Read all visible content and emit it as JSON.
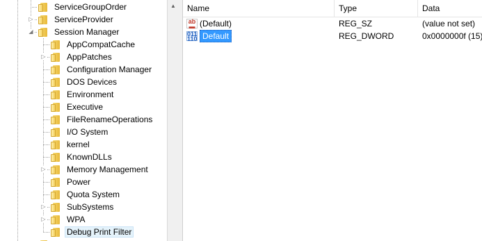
{
  "tree": {
    "items": [
      {
        "label": "ServiceGroupOrder",
        "level": 1,
        "expander": "none"
      },
      {
        "label": "ServiceProvider",
        "level": 1,
        "expander": "collapsed"
      },
      {
        "label": "Session Manager",
        "level": 1,
        "expander": "expanded"
      },
      {
        "label": "AppCompatCache",
        "level": 2,
        "expander": "none"
      },
      {
        "label": "AppPatches",
        "level": 2,
        "expander": "collapsed"
      },
      {
        "label": "Configuration Manager",
        "level": 2,
        "expander": "none"
      },
      {
        "label": "DOS Devices",
        "level": 2,
        "expander": "none"
      },
      {
        "label": "Environment",
        "level": 2,
        "expander": "none"
      },
      {
        "label": "Executive",
        "level": 2,
        "expander": "none"
      },
      {
        "label": "FileRenameOperations",
        "level": 2,
        "expander": "none"
      },
      {
        "label": "I/O System",
        "level": 2,
        "expander": "none"
      },
      {
        "label": "kernel",
        "level": 2,
        "expander": "none"
      },
      {
        "label": "KnownDLLs",
        "level": 2,
        "expander": "none"
      },
      {
        "label": "Memory Management",
        "level": 2,
        "expander": "collapsed"
      },
      {
        "label": "Power",
        "level": 2,
        "expander": "none"
      },
      {
        "label": "Quota System",
        "level": 2,
        "expander": "none"
      },
      {
        "label": "SubSystems",
        "level": 2,
        "expander": "collapsed"
      },
      {
        "label": "WPA",
        "level": 2,
        "expander": "collapsed"
      },
      {
        "label": "Debug Print Filter",
        "level": 2,
        "expander": "none",
        "selected": true
      }
    ]
  },
  "list": {
    "columns": [
      "Name",
      "Type",
      "Data"
    ],
    "rows": [
      {
        "icon": "string-value-icon",
        "name": "(Default)",
        "type": "REG_SZ",
        "data": "(value not set)"
      },
      {
        "icon": "dword-value-icon",
        "name": "Default",
        "type": "REG_DWORD",
        "data": "0x0000000f (15)",
        "selected": true,
        "editing": true
      }
    ]
  }
}
